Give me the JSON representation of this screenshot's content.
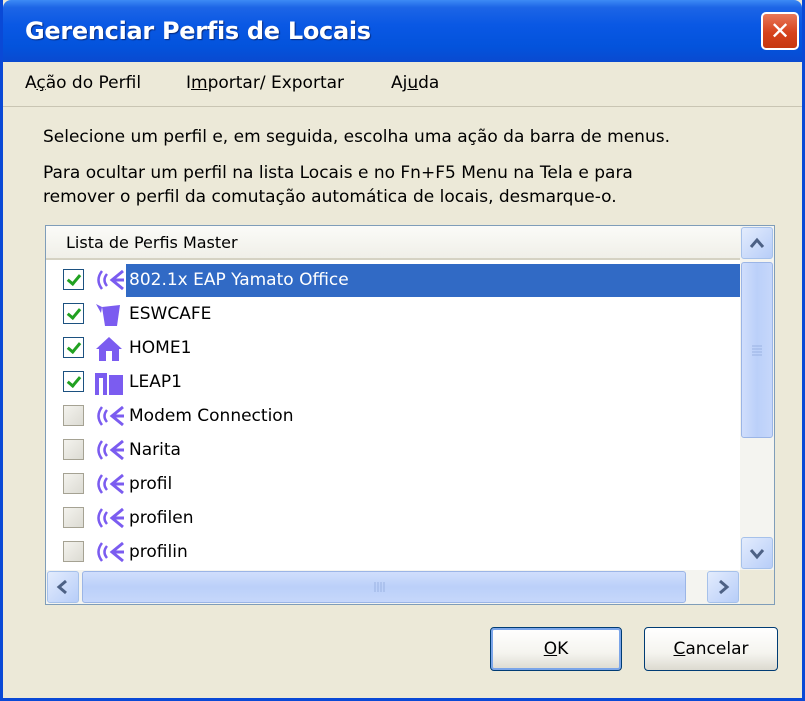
{
  "window": {
    "title": "Gerenciar Perfis de Locais",
    "close_glyph": "✕"
  },
  "menu": {
    "items": [
      {
        "pre": "A",
        "key": "ç",
        "post": "ão do Perfil"
      },
      {
        "pre": "I",
        "key": "m",
        "post": "portar/ Exportar"
      },
      {
        "pre": "Aj",
        "key": "u",
        "post": "da"
      }
    ]
  },
  "instructions": {
    "line1": "Selecione um perfil e, em seguida, escolha uma ação da barra de menus.",
    "line2a": "Para ocultar um perfil na lista Locais e no Fn+F5 Menu na Tela e para",
    "line2b": "remover o perfil da comutação automática de locais, desmarque-o."
  },
  "list": {
    "header": "Lista de Perfis Master",
    "rows": [
      {
        "label": "802.1x EAP Yamato Office",
        "checked": true,
        "selected": true,
        "icon": "wireless-icon"
      },
      {
        "label": "ESWCAFE",
        "checked": true,
        "selected": false,
        "icon": "coffee-cup-icon"
      },
      {
        "label": "HOME1",
        "checked": true,
        "selected": false,
        "icon": "house-icon"
      },
      {
        "label": "LEAP1",
        "checked": true,
        "selected": false,
        "icon": "building-icon"
      },
      {
        "label": "Modem Connection",
        "checked": false,
        "selected": false,
        "icon": "wireless-icon"
      },
      {
        "label": "Narita",
        "checked": false,
        "selected": false,
        "icon": "wireless-icon"
      },
      {
        "label": "profil",
        "checked": false,
        "selected": false,
        "icon": "wireless-icon"
      },
      {
        "label": "profilen",
        "checked": false,
        "selected": false,
        "icon": "wireless-icon"
      },
      {
        "label": "profilin",
        "checked": false,
        "selected": false,
        "icon": "wireless-icon"
      }
    ]
  },
  "buttons": {
    "ok": {
      "key": "O",
      "rest": "K"
    },
    "cancel": {
      "key": "C",
      "rest": "ancelar"
    }
  },
  "colors": {
    "title_bar": "#0a58e4",
    "selection": "#316ac5",
    "icon": "#7b5cf0"
  }
}
